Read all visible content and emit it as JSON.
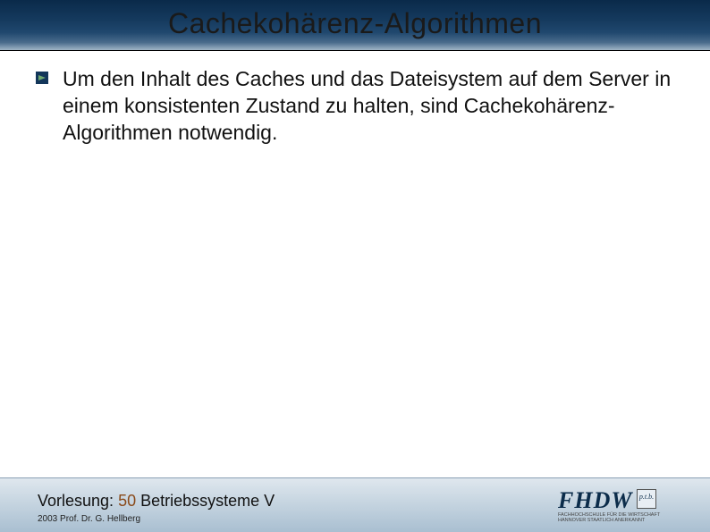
{
  "title": "Cachekohärenz-Algorithmen",
  "body": {
    "bullet": "Um den Inhalt des Caches und das Dateisystem auf dem Server in einem konsistenten Zustand zu halten, sind Cachekohärenz-Algorithmen notwendig."
  },
  "footer": {
    "lecture_label": "Vorlesung:",
    "slide_number": "50",
    "lecture_title": "Betriebssysteme V",
    "copyright": "2003 Prof. Dr. G. Hellberg"
  },
  "logo": {
    "main": "FHDW",
    "square": "p.t.b.",
    "sub1": "FACHHOCHSCHULE FÜR DIE WIRTSCHAFT",
    "sub2": "HANNOVER       STAATLICH ANERKANNT"
  }
}
